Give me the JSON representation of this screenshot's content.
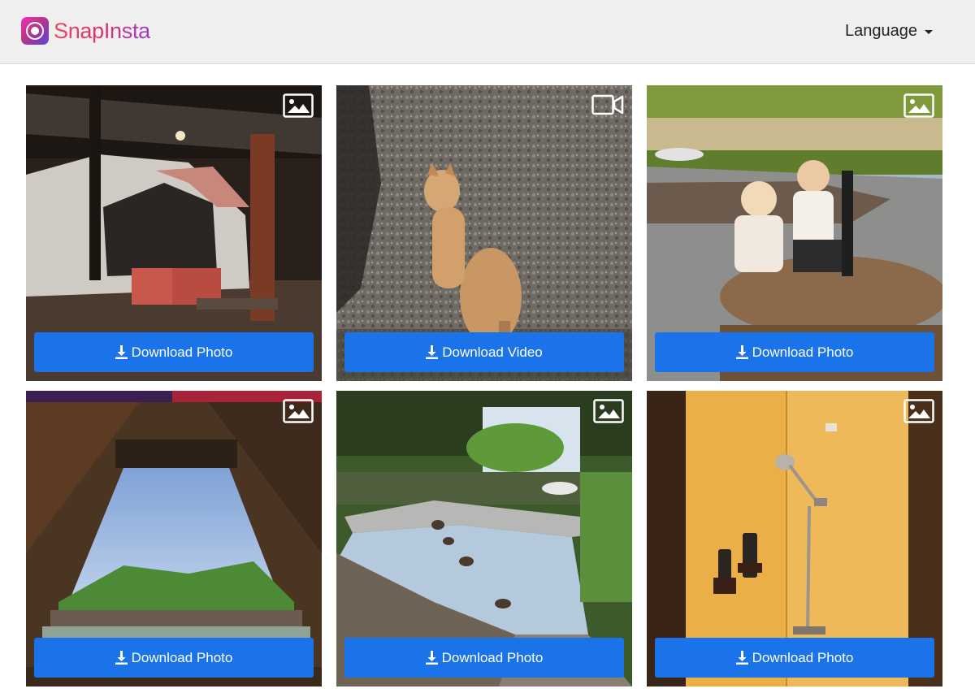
{
  "header": {
    "brand": "SnapInsta",
    "language_label": "Language"
  },
  "cards": [
    {
      "media_type": "photo",
      "type_icon": "image-icon",
      "button_label": "Download Photo"
    },
    {
      "media_type": "video",
      "type_icon": "video-camera-icon",
      "button_label": "Download Video"
    },
    {
      "media_type": "photo",
      "type_icon": "image-icon",
      "button_label": "Download Photo"
    },
    {
      "media_type": "photo",
      "type_icon": "image-icon",
      "button_label": "Download Photo"
    },
    {
      "media_type": "photo",
      "type_icon": "image-icon",
      "button_label": "Download Photo"
    },
    {
      "media_type": "photo",
      "type_icon": "image-icon",
      "button_label": "Download Photo"
    }
  ],
  "colors": {
    "button": "#1a73e8",
    "navbar": "#efefef",
    "brand_gradient_start": "#ef4a60",
    "brand_gradient_end": "#a13cc4"
  }
}
